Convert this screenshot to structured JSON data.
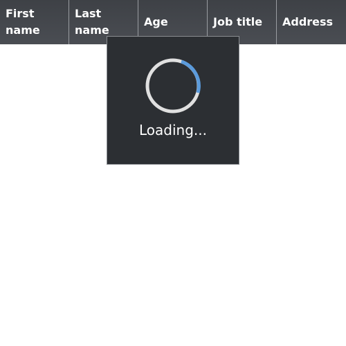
{
  "grid": {
    "columns": [
      {
        "label": "First name"
      },
      {
        "label": "Last name"
      },
      {
        "label": "Age"
      },
      {
        "label": "Job title"
      },
      {
        "label": "Address"
      }
    ]
  },
  "loading": {
    "text": "Loading...",
    "spinner_track_color": "#e0e0e0",
    "spinner_accent_color": "#5b9bdc",
    "overlay_color": "#2c2f33"
  },
  "colors": {
    "header_bg": "#43464b",
    "header_text": "#ffffff",
    "body_bg": "#ffffff"
  }
}
